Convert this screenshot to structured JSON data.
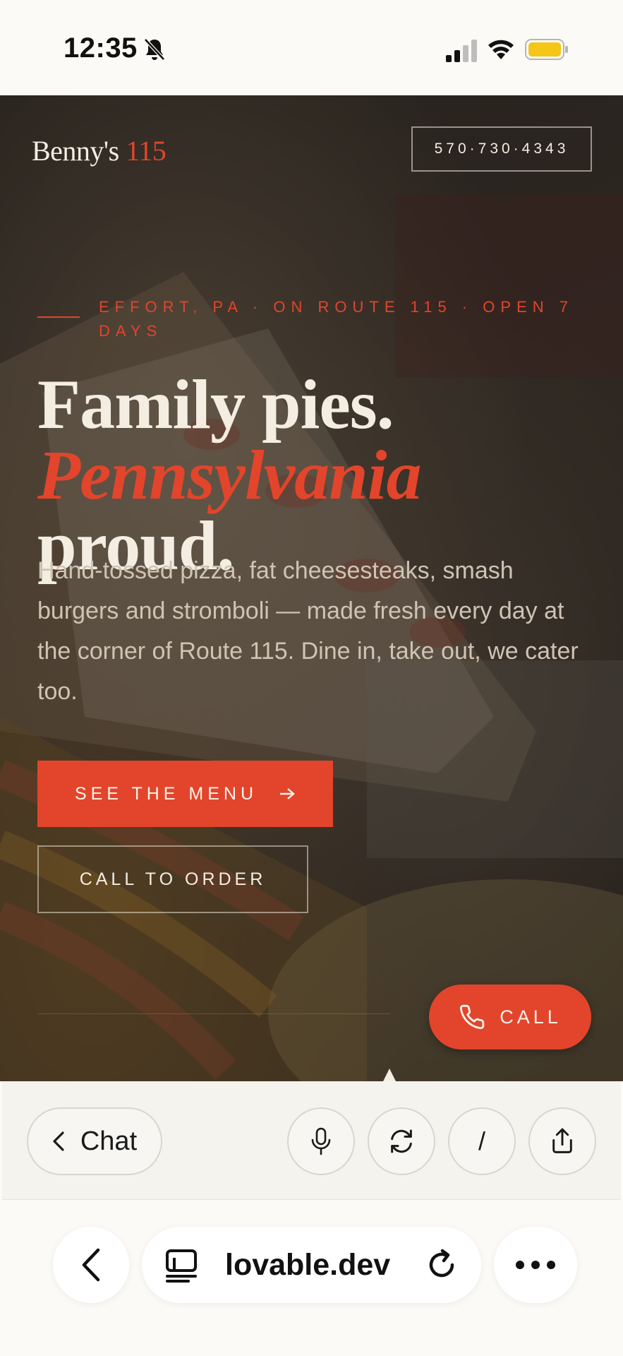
{
  "status_bar": {
    "time": "12:35"
  },
  "site": {
    "logo_name": "Benny's",
    "logo_number": "115",
    "phone": "570·730·4343",
    "eyebrow": "EFFORT, PA · ON ROUTE 115 · OPEN 7 DAYS",
    "headline_line1": "Family pies.",
    "headline_accent": "Pennsylvania",
    "headline_rest": "proud.",
    "description": "Hand-tossed pizza, fat cheesesteaks, smash burgers and stromboli — made fresh every day at the corner of Route 115. Dine in, take out, we cater too.",
    "menu_button": "SEE THE MENU",
    "call_order_button": "CALL TO ORDER",
    "call_fab": "CALL"
  },
  "toolbar": {
    "chat_label": "Chat",
    "slash_label": "/"
  },
  "browser": {
    "url": "lovable.dev"
  },
  "colors": {
    "accent": "#e2452b",
    "cream": "#f4ede1",
    "page_bg": "#fbfaf6"
  },
  "icons": [
    "bell-slash-icon",
    "signal-icon",
    "wifi-icon",
    "battery-icon",
    "arrow-right-icon",
    "phone-icon",
    "chevron-left-icon",
    "microphone-icon",
    "refresh-icon",
    "share-icon",
    "tabs-icon",
    "reload-icon",
    "more-icon"
  ]
}
